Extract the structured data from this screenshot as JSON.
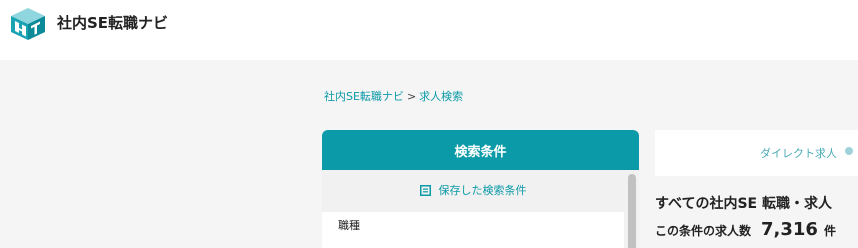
{
  "header": {
    "site_name": "社内SE転職ナビ",
    "logo_icon": "cube-logo-icon",
    "accent": "#0b9aa8"
  },
  "breadcrumb": {
    "home": "社内SE転職ナビ",
    "separator": ">",
    "current": "求人検索"
  },
  "search_panel": {
    "title": "検索条件",
    "saved_link": "保存した検索条件",
    "saved_icon": "saved-list-icon",
    "first_field_label": "職種"
  },
  "results": {
    "tab_label": "ダイレクト求人",
    "title": "すべての社内SE 転職・求人",
    "count_label": "この条件の求人数",
    "count_value": "7,316",
    "count_unit": "件"
  }
}
